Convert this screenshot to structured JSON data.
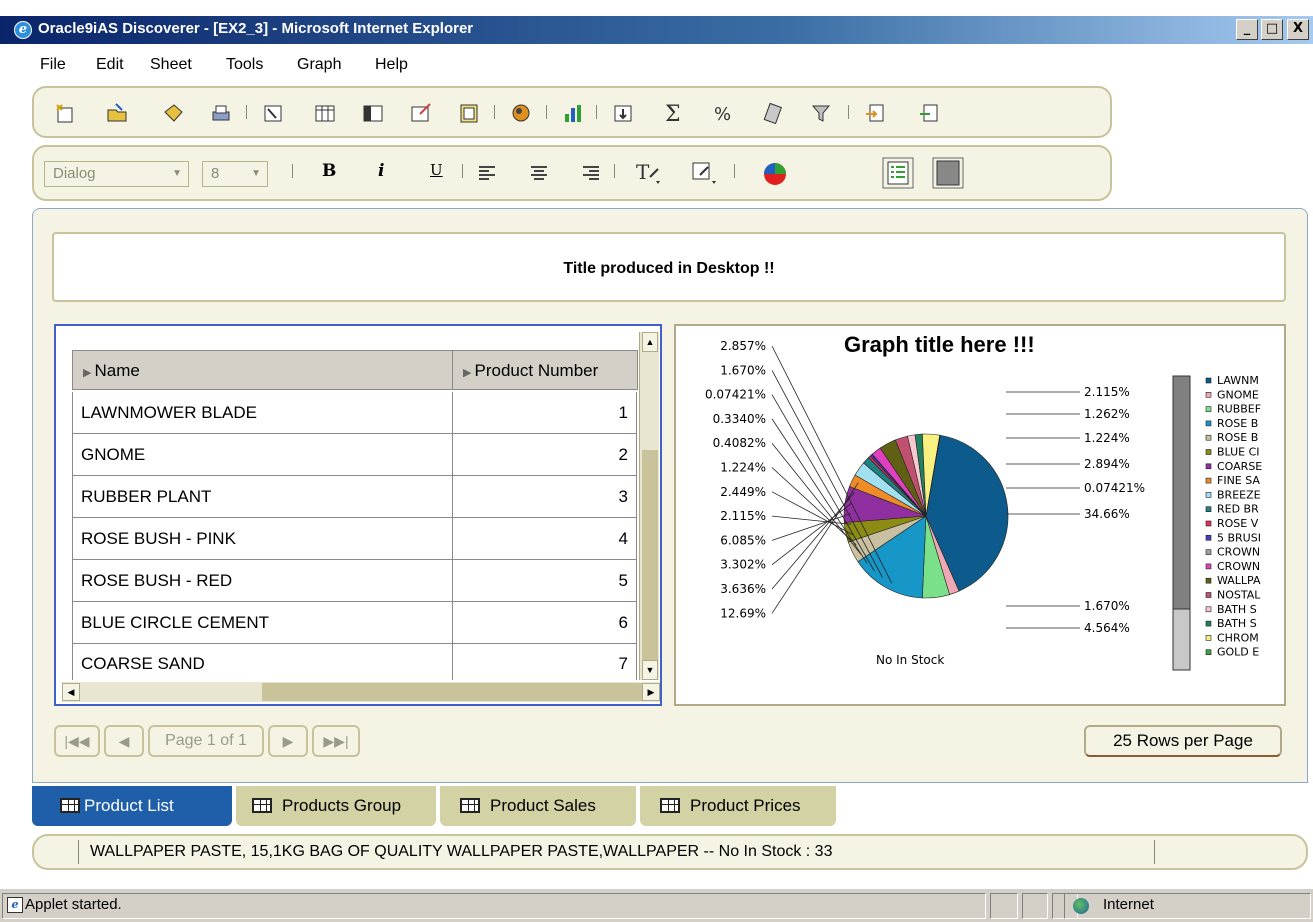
{
  "window": {
    "title": "Oracle9iAS Discoverer - [EX2_3] - Microsoft Internet Explorer",
    "buttons": {
      "minimize": "_",
      "maximize": "□",
      "close": "X"
    }
  },
  "menu": {
    "items": [
      {
        "label": "File"
      },
      {
        "label": "Edit"
      },
      {
        "label": "Sheet"
      },
      {
        "label": "Tools"
      },
      {
        "label": "Graph"
      },
      {
        "label": "Help"
      }
    ]
  },
  "format_toolbar": {
    "font_family": "Dialog",
    "font_size": "8",
    "bold": "B",
    "italic": "i",
    "underline": "U"
  },
  "worksheet": {
    "title": "Title produced in Desktop !!",
    "table": {
      "columns": [
        "Name",
        "Product Number"
      ],
      "rows": [
        {
          "name": "LAWNMOWER BLADE",
          "number": "1"
        },
        {
          "name": "GNOME",
          "number": "2"
        },
        {
          "name": "RUBBER PLANT",
          "number": "3"
        },
        {
          "name": "ROSE BUSH - PINK",
          "number": "4"
        },
        {
          "name": "ROSE BUSH - RED",
          "number": "5"
        },
        {
          "name": "BLUE CIRCLE CEMENT",
          "number": "6"
        },
        {
          "name": "COARSE SAND",
          "number": "7"
        }
      ]
    },
    "pagination": {
      "page_label": "Page 1 of 1",
      "rows_per_page": "25 Rows per Page"
    }
  },
  "chart_data": {
    "type": "pie",
    "title": "Graph title here !!!",
    "xlabel": "No In Stock",
    "left_labels": [
      "2.857%",
      "1.670%",
      "0.07421%",
      "0.3340%",
      "0.4082%",
      "1.224%",
      "2.449%",
      "2.115%",
      "6.085%",
      "3.302%",
      "3.636%",
      "12.69%"
    ],
    "right_labels": [
      "2.115%",
      "1.262%",
      "1.224%",
      "2.894%",
      "0.07421%",
      "34.66%",
      "1.670%",
      "4.564%"
    ],
    "slices": [
      {
        "label": "LAWNM",
        "value": 34.66,
        "color": "#0d5a8c"
      },
      {
        "label": "GNOME",
        "value": 1.67,
        "color": "#f0a8b4"
      },
      {
        "label": "RUBBEF",
        "value": 4.564,
        "color": "#7ae08a"
      },
      {
        "label": "ROSE B",
        "value": 12.69,
        "color": "#1796c8"
      },
      {
        "label": "ROSE B",
        "value": 3.636,
        "color": "#c8c0a0"
      },
      {
        "label": "BLUE CI",
        "value": 3.302,
        "color": "#8c8c14"
      },
      {
        "label": "COARSE",
        "value": 6.085,
        "color": "#9030a0"
      },
      {
        "label": "FINE SA",
        "value": 2.115,
        "color": "#f08c28"
      },
      {
        "label": "BREEZE",
        "value": 2.449,
        "color": "#a0e0f0"
      },
      {
        "label": "RED BR",
        "value": 1.224,
        "color": "#208080"
      },
      {
        "label": "ROSE V",
        "value": 0.4082,
        "color": "#e03060"
      },
      {
        "label": "5 BRUSI",
        "value": 0.334,
        "color": "#4040c0"
      },
      {
        "label": "CROWN",
        "value": 0.07421,
        "color": "#a0a0a0"
      },
      {
        "label": "CROWN",
        "value": 1.67,
        "color": "#e040c0"
      },
      {
        "label": "WALLPA",
        "value": 2.857,
        "color": "#606014"
      },
      {
        "label": "NOSTAL",
        "value": 2.115,
        "color": "#c05070"
      },
      {
        "label": "BATH S",
        "value": 1.262,
        "color": "#f8c8d0"
      },
      {
        "label": "BATH S",
        "value": 1.224,
        "color": "#208060"
      },
      {
        "label": "CHROM",
        "value": 2.894,
        "color": "#f8f080"
      },
      {
        "label": "GOLD E",
        "value": 0.07421,
        "color": "#40a040"
      }
    ]
  },
  "sheet_tabs": [
    {
      "label": "Product List",
      "active": true
    },
    {
      "label": "Products Group",
      "active": false
    },
    {
      "label": "Product Sales",
      "active": false
    },
    {
      "label": "Product Prices",
      "active": false
    }
  ],
  "status_strip": {
    "text": "WALLPAPER PASTE, 15,1KG BAG OF QUALITY WALLPAPER PASTE,WALLPAPER  -- No In Stock :  33"
  },
  "statusbar": {
    "left": "Applet started.",
    "zone": "Internet"
  }
}
